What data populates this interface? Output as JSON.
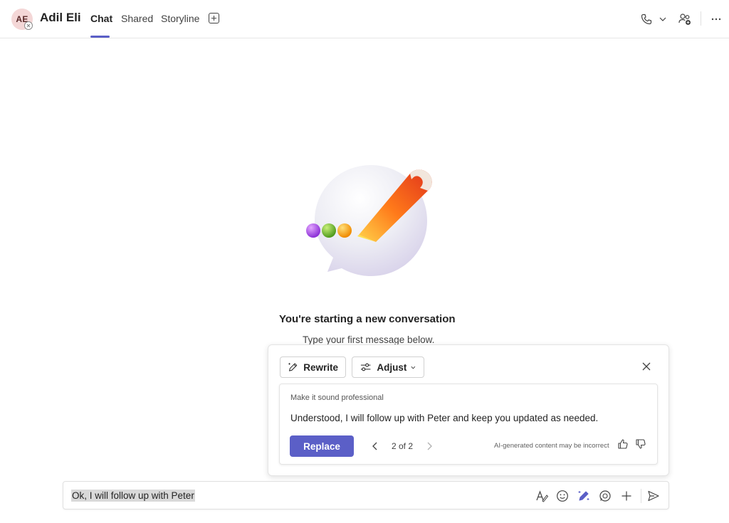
{
  "header": {
    "avatar_initials": "AE",
    "contact_name": "Adil Eli",
    "tabs": [
      {
        "label": "Chat",
        "active": true
      },
      {
        "label": "Shared",
        "active": false
      },
      {
        "label": "Storyline",
        "active": false
      }
    ],
    "icons": [
      "add-tab-icon",
      "phone-icon",
      "chevron-down-icon",
      "people-add-icon",
      "more-icon"
    ]
  },
  "empty_state": {
    "title": "You're starting a new conversation",
    "subtitle": "Type your first message below."
  },
  "copilot_panel": {
    "rewrite_label": "Rewrite",
    "adjust_label": "Adjust",
    "suggestion_hint": "Make it sound professional",
    "suggestion_text": "Understood, I will follow up with Peter and keep you updated as needed.",
    "replace_label": "Replace",
    "pager": "2 of 2",
    "disclaimer": "AI-generated content may be incorrect"
  },
  "compose": {
    "text": "Ok, I will follow up with Peter",
    "icons": [
      "format-icon",
      "emoji-icon",
      "copilot-rewrite-icon",
      "loop-icon",
      "plus-icon",
      "send-icon"
    ]
  },
  "colors": {
    "accent": "#5b5fc7",
    "avatar_bg": "#f4d7d7"
  }
}
